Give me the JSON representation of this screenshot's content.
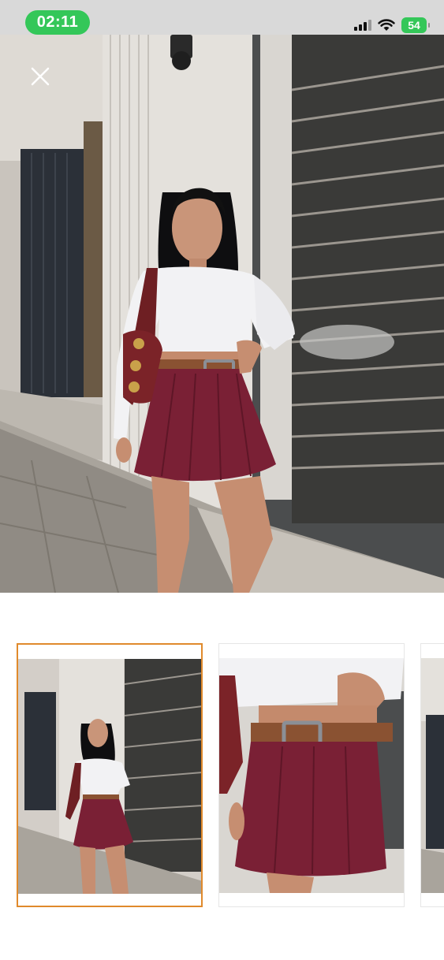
{
  "status_bar": {
    "time": "02:11",
    "battery": "54"
  },
  "hero": {
    "image_subject": "model-white-top-burgundy-skirt-photo"
  },
  "colors": {
    "status_bg": "#d9d9d9",
    "clock_pill": "#34c759",
    "selected_border": "#e08a2c",
    "skirt": "#7a2035",
    "top": "#f2f2f4",
    "belt": "#8a5232"
  },
  "icons": [
    "close-icon",
    "signal-icon",
    "wifi-icon",
    "battery-icon"
  ],
  "thumbnails": [
    {
      "label": "full-body-view",
      "selected": true
    },
    {
      "label": "skirt-closeup-view",
      "selected": false
    },
    {
      "label": "partial-view",
      "selected": false
    }
  ]
}
